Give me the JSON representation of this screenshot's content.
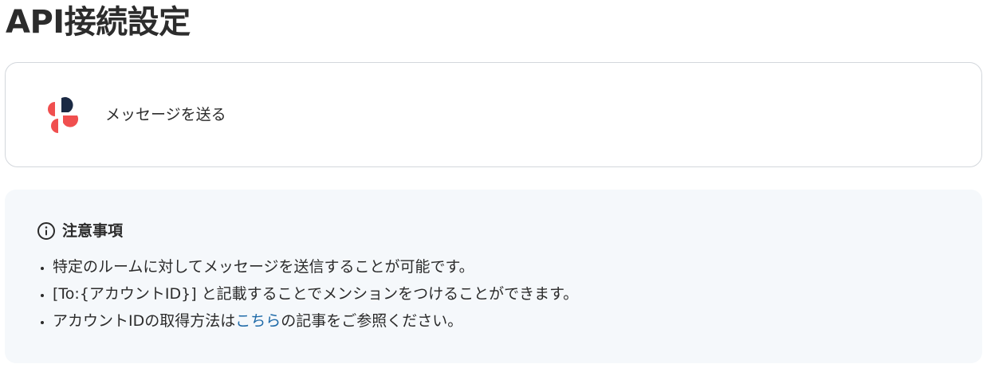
{
  "page": {
    "title": "API接続設定"
  },
  "action": {
    "label": "メッセージを送る",
    "icon": "chatwork-logo-icon"
  },
  "notice": {
    "title": "注意事項",
    "icon": "info-icon",
    "items": [
      {
        "text": "特定のルームに対してメッセージを送信することが可能です。"
      },
      {
        "text": "[To:{アカウントID}] と記載することでメンションをつけることができます。"
      },
      {
        "prefix": "アカウントIDの取得方法は",
        "link": "こちら",
        "suffix": "の記事をご参照ください。"
      }
    ]
  },
  "colors": {
    "logo_red": "#f04f4f",
    "logo_navy": "#1b2a44",
    "link": "#1e6aa8",
    "notice_bg": "#f5f8fb",
    "card_border": "#d3d7dc"
  }
}
